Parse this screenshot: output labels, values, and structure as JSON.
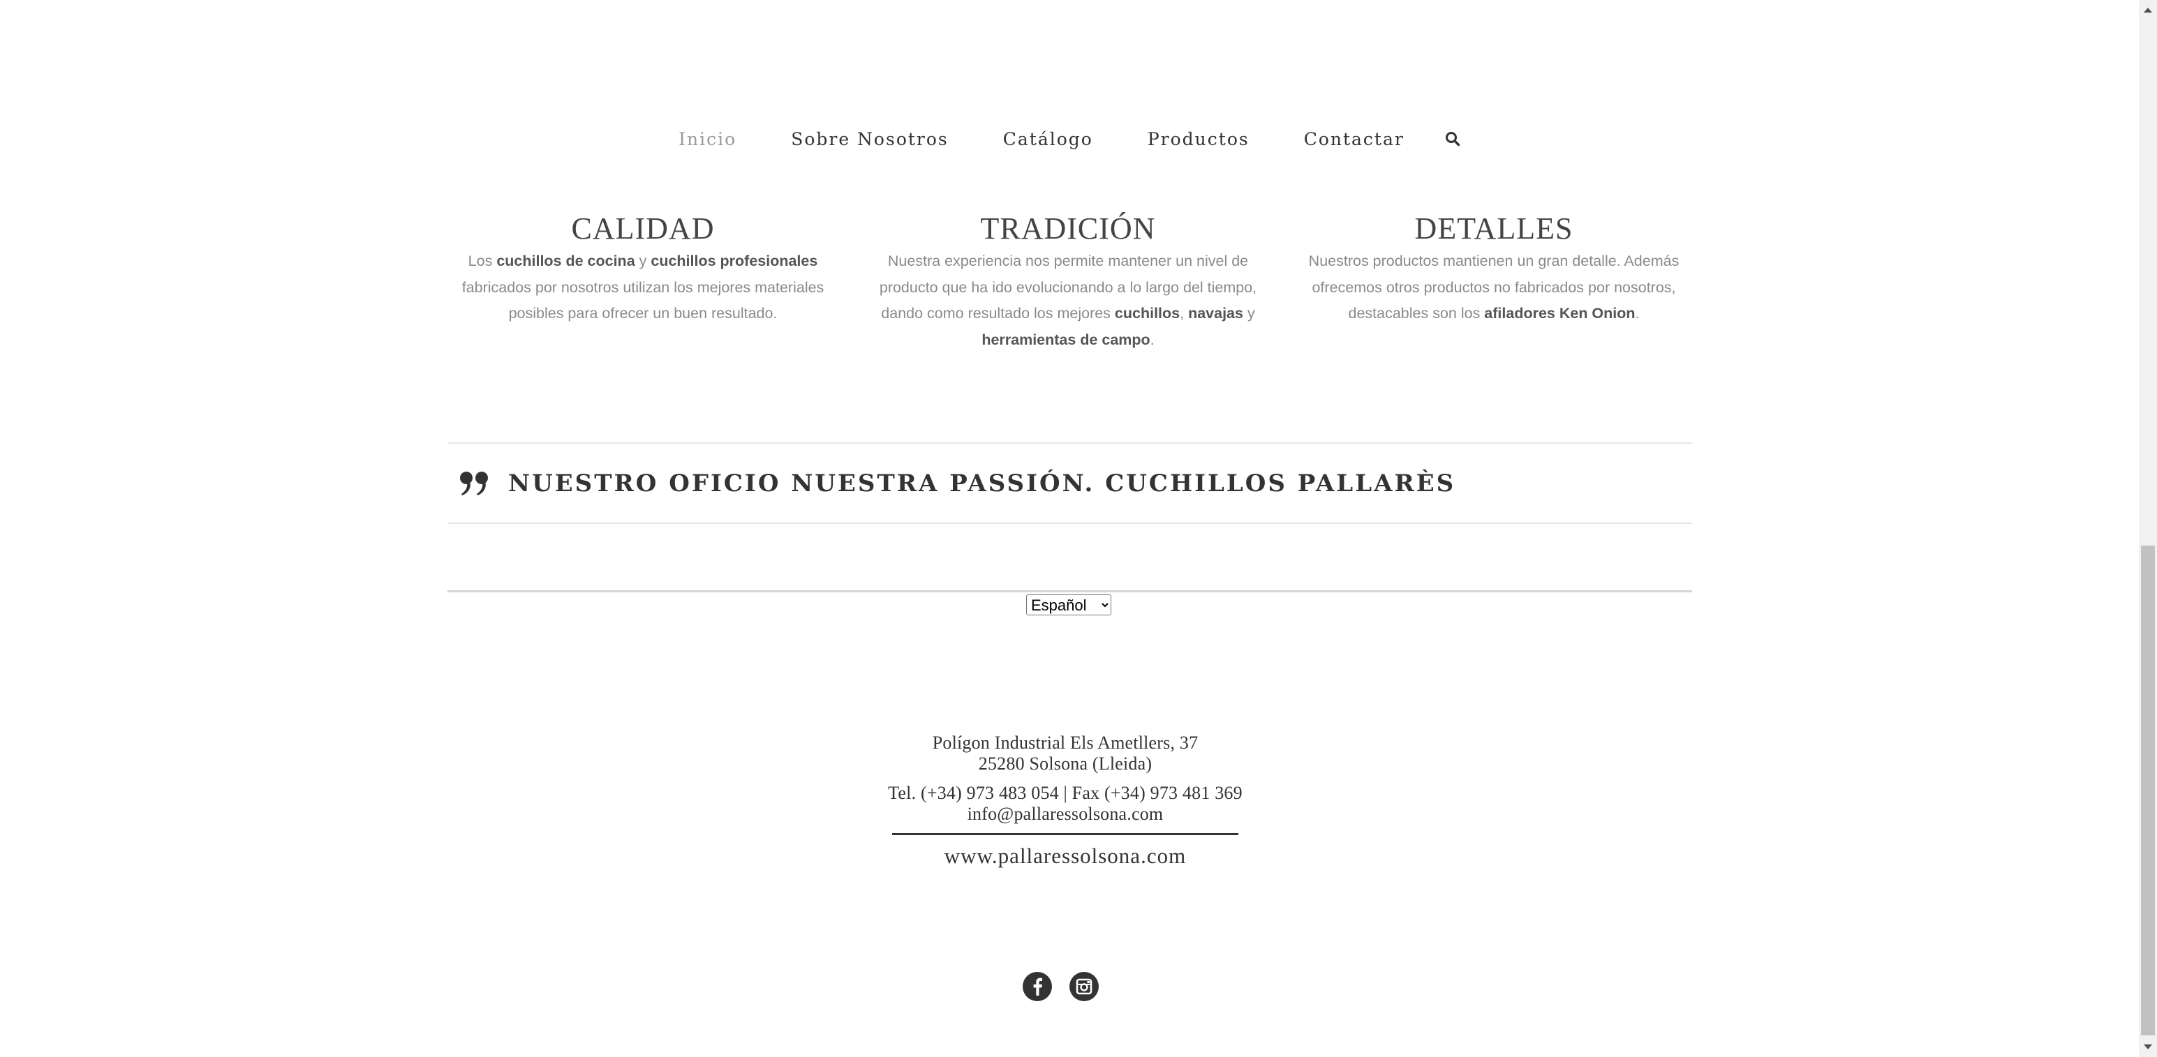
{
  "nav": {
    "items": [
      {
        "label": "Inicio",
        "active": true
      },
      {
        "label": "Sobre Nosotros",
        "active": false
      },
      {
        "label": "Catálogo",
        "active": false
      },
      {
        "label": "Productos",
        "active": false
      },
      {
        "label": "Contactar",
        "active": false
      }
    ],
    "search_icon": "search-icon"
  },
  "features": [
    {
      "title": "CALIDAD",
      "text": [
        {
          "t": "Los "
        },
        {
          "t": "cuchillos de cocina",
          "b": true
        },
        {
          "t": " y "
        },
        {
          "t": "cuchillos profesionales",
          "b": true
        },
        {
          "t": " fabricados por nosotros utilizan los mejores materiales posibles para ofrecer un buen resultado."
        }
      ]
    },
    {
      "title": "TRADICIÓN",
      "text": [
        {
          "t": "Nuestra experiencia nos permite mantener un nivel de producto que ha ido evolucionando a lo largo del tiempo, dando como resultado los mejores "
        },
        {
          "t": "cuchillos",
          "b": true
        },
        {
          "t": ", "
        },
        {
          "t": "navajas",
          "b": true
        },
        {
          "t": " y "
        },
        {
          "t": "herramientas de campo",
          "b": true
        },
        {
          "t": "."
        }
      ]
    },
    {
      "title": "DETALLES",
      "text": [
        {
          "t": "Nuestros productos mantienen un gran detalle. Además ofrecemos otros productos no fabricados por nosotros, destacables son los "
        },
        {
          "t": "afiladores Ken Onion",
          "b": true
        },
        {
          "t": "."
        }
      ]
    }
  ],
  "quote": {
    "icon": "quote-icon",
    "text": "NUESTRO OFICIO NUESTRA PASSIÓN. CUCHILLOS PALLARÈS"
  },
  "language": {
    "selected": "Español"
  },
  "address": {
    "line1": "Polígon Industrial Els Ametllers, 37",
    "line2": "25280 Solsona (Lleida)",
    "phone_line": "Tel. (+34) 973 483 054 | Fax (+34) 973 481 369",
    "email": "info@pallaressolsona.com",
    "website": "www.pallaressolsona.com"
  },
  "social": {
    "icons": [
      "facebook-icon",
      "instagram-icon"
    ]
  },
  "scrollbar": {
    "position": 0.52,
    "visible_fraction": 0.47
  },
  "colors": {
    "text_dark": "#333333",
    "text_muted": "#8a8a8a",
    "nav_active": "#9a9a9a",
    "divider": "#e6e6e6"
  }
}
